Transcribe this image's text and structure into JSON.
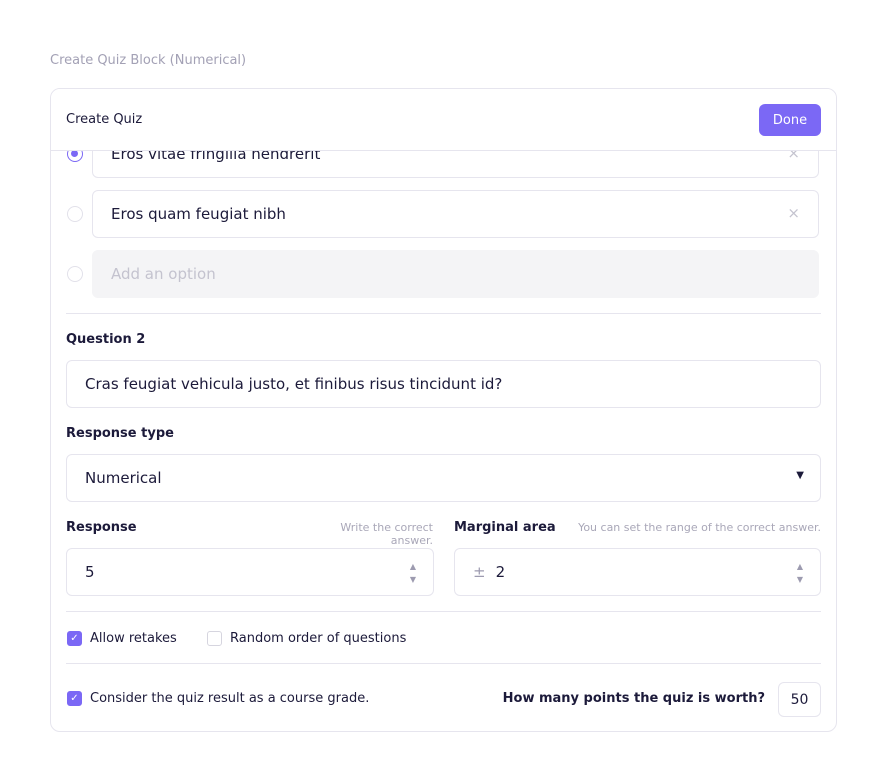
{
  "page_title": "Create Quiz Block (Numerical)",
  "header": {
    "title": "Create Quiz",
    "done_label": "Done"
  },
  "options": [
    {
      "text": "Eros vitae fringilla hendrerit",
      "selected": true,
      "remove": "×"
    },
    {
      "text": "Eros quam feugiat nibh",
      "selected": false,
      "remove": "×"
    }
  ],
  "add_option_placeholder": "Add an option",
  "question": {
    "label": "Question 2",
    "value": "Cras feugiat vehicula justo, et finibus risus tincidunt id?"
  },
  "response_type": {
    "label": "Response type",
    "value": "Numerical",
    "icon": "caret-down-icon"
  },
  "response": {
    "label": "Response",
    "hint": "Write the correct answer.",
    "value": "5"
  },
  "marginal": {
    "label": "Marginal area",
    "hint": "You can set the range of the correct answer.",
    "prefix": "±",
    "value": "2"
  },
  "checkboxes": {
    "allow_retakes": {
      "label": "Allow retakes",
      "checked": true
    },
    "random_order": {
      "label": "Random order of questions",
      "checked": false
    },
    "course_grade": {
      "label": "Consider the quiz result as a course grade.",
      "checked": true
    }
  },
  "points": {
    "label": "How many points the quiz is worth?",
    "value": "50"
  },
  "colors": {
    "accent": "#7b68f5"
  }
}
